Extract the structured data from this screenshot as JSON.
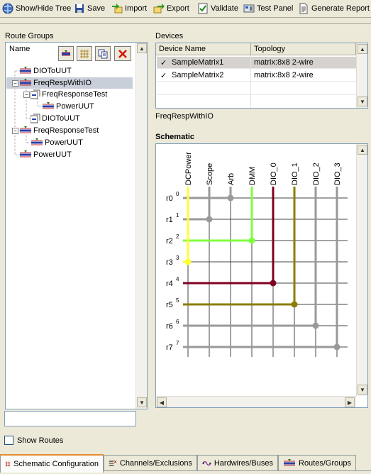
{
  "toolbar": {
    "show_hide_tree": "Show/Hide Tree",
    "save": "Save",
    "import": "Import",
    "export": "Export",
    "validate": "Validate",
    "test_panel": "Test Panel",
    "generate_report": "Generate Report"
  },
  "route_groups": {
    "title": "Route Groups",
    "column_header": "Name",
    "items": [
      {
        "label": "DIOToUUT",
        "level": 0
      },
      {
        "label": "FreqRespWithIO",
        "level": 0,
        "selected": true
      },
      {
        "label": "FreqResponseTest",
        "level": 1
      },
      {
        "label": "PowerUUT",
        "level": 2
      },
      {
        "label": "DIOToUUT",
        "level": 1
      },
      {
        "label": "FreqResponseTest",
        "level": 0
      },
      {
        "label": "PowerUUT",
        "level": 1
      },
      {
        "label": "PowerUUT",
        "level": 0
      }
    ],
    "filter_value": ""
  },
  "devices": {
    "title": "Devices",
    "columns": [
      "Device Name",
      "Topology"
    ],
    "rows": [
      {
        "check": "✓",
        "name": "SampleMatrix1",
        "topology": "matrix:8x8 2-wire",
        "selected": true
      },
      {
        "check": "✓",
        "name": "SampleMatrix2",
        "topology": "matrix:8x8 2-wire",
        "selected": false
      }
    ],
    "current_route": "FreqRespWithIO"
  },
  "schematic": {
    "title": "Schematic",
    "columns": [
      "DCPower",
      "Scope",
      "Arb",
      "DMM",
      "DIO_0",
      "DIO_1",
      "DIO_2",
      "DIO_3"
    ],
    "rows": [
      "r0",
      "r1",
      "r2",
      "r3",
      "r4",
      "r5",
      "r6",
      "r7"
    ],
    "row_indices": [
      "0",
      "1",
      "2",
      "3",
      "4",
      "5",
      "6",
      "7"
    ],
    "connections": [
      {
        "row": 0,
        "col": 2,
        "color": "#999999"
      },
      {
        "row": 1,
        "col": 1,
        "color": "#999999"
      },
      {
        "row": 2,
        "col": 3,
        "color": "#7fff3f"
      },
      {
        "row": 3,
        "col": 0,
        "color": "#ffff33"
      },
      {
        "row": 4,
        "col": 4,
        "color": "#800020"
      },
      {
        "row": 5,
        "col": 5,
        "color": "#8b7d00"
      },
      {
        "row": 6,
        "col": 6,
        "color": "#999999"
      },
      {
        "row": 7,
        "col": 7,
        "color": "#999999"
      }
    ]
  },
  "show_routes": {
    "label": "Show Routes",
    "checked": false
  },
  "tabs": [
    {
      "label": "Schematic Configuration",
      "active": true
    },
    {
      "label": "Channels/Exclusions",
      "active": false
    },
    {
      "label": "Hardwires/Buses",
      "active": false
    },
    {
      "label": "Routes/Groups",
      "active": false
    }
  ]
}
